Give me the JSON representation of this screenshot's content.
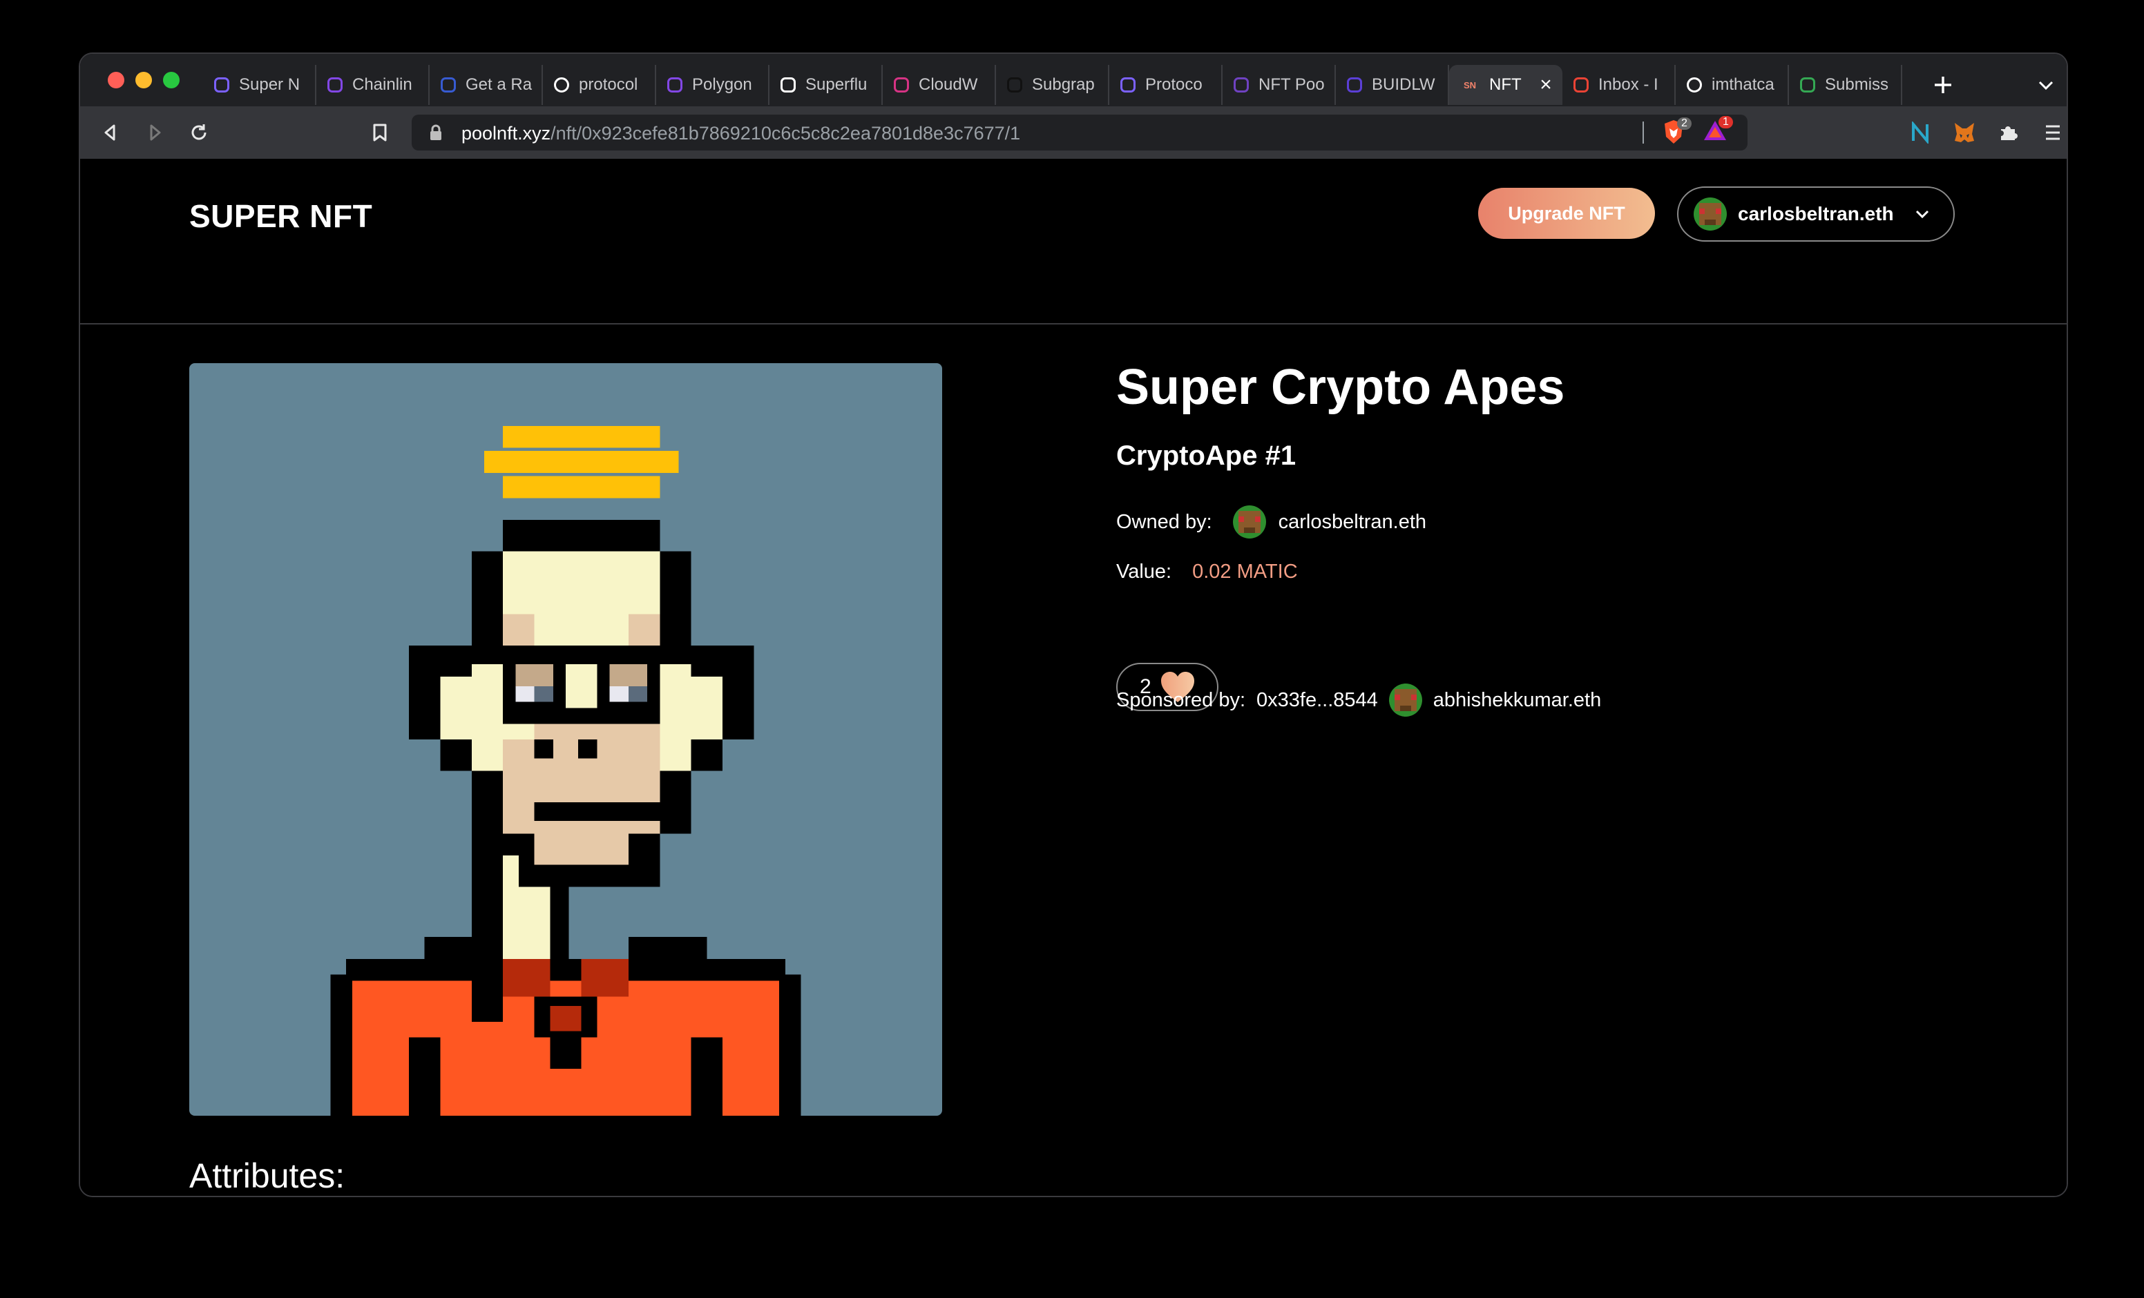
{
  "browser": {
    "tabs": [
      {
        "label": "Super N",
        "icon": "super-nft-icon",
        "color": "#7b61ff"
      },
      {
        "label": "Chainlin",
        "icon": "polygon-icon",
        "color": "#8247e5"
      },
      {
        "label": "Get a Ra",
        "icon": "chainlink-icon",
        "color": "#375bd2"
      },
      {
        "label": "protocol",
        "icon": "github-icon",
        "color": "#ffffff"
      },
      {
        "label": "Polygon",
        "icon": "polygon-icon",
        "color": "#8247e5"
      },
      {
        "label": "Superflu",
        "icon": "superfluid-icon",
        "color": "#ffffff"
      },
      {
        "label": "CloudW",
        "icon": "cloudwall-icon",
        "color": "#d63384"
      },
      {
        "label": "Subgrap",
        "icon": "subgraph-icon",
        "color": "#111111"
      },
      {
        "label": "Protoco",
        "icon": "super-nft-icon",
        "color": "#7b61ff"
      },
      {
        "label": "NFT Poo",
        "icon": "nft-pool-icon",
        "color": "#6f42c1"
      },
      {
        "label": "BUIDLW",
        "icon": "buidl-icon",
        "color": "#5b3fd6"
      },
      {
        "label": "NFT",
        "icon": "sn-icon",
        "color": "#f2836b",
        "active": true,
        "favicon_text": "SN"
      },
      {
        "label": "Inbox - I",
        "icon": "gmail-icon",
        "color": "#ea4335"
      },
      {
        "label": "imthatca",
        "icon": "github-icon",
        "color": "#ffffff"
      },
      {
        "label": "Submiss",
        "icon": "submissions-icon",
        "color": "#34a853"
      }
    ],
    "url_host": "poolnft.xyz",
    "url_path": "/nft/0x923cefe81b7869210c6c5c8c2ea7801d8e3c7677/1",
    "brave_badge": "2",
    "rewards_badge": "1"
  },
  "header": {
    "brand": "SUPER NFT",
    "upgrade_label": "Upgrade NFT",
    "account_name": "carlosbeltran.eth"
  },
  "nft": {
    "collection": "Super Crypto Apes",
    "name": "CryptoApe #1",
    "owned_label": "Owned by:",
    "owner": "carlosbeltran.eth",
    "value_label": "Value:",
    "value": "0.02 MATIC",
    "likes": "2",
    "sponsored_label": "Sponsored by:",
    "sponsor_address": "0x33fe...8544",
    "sponsor_name": "abhishekkumar.eth",
    "attributes_label": "Attributes:"
  },
  "colors": {
    "accent_start": "#e8826b",
    "accent_end": "#f2bd90",
    "value_color": "#f29d84",
    "nft_background": "#638596"
  }
}
